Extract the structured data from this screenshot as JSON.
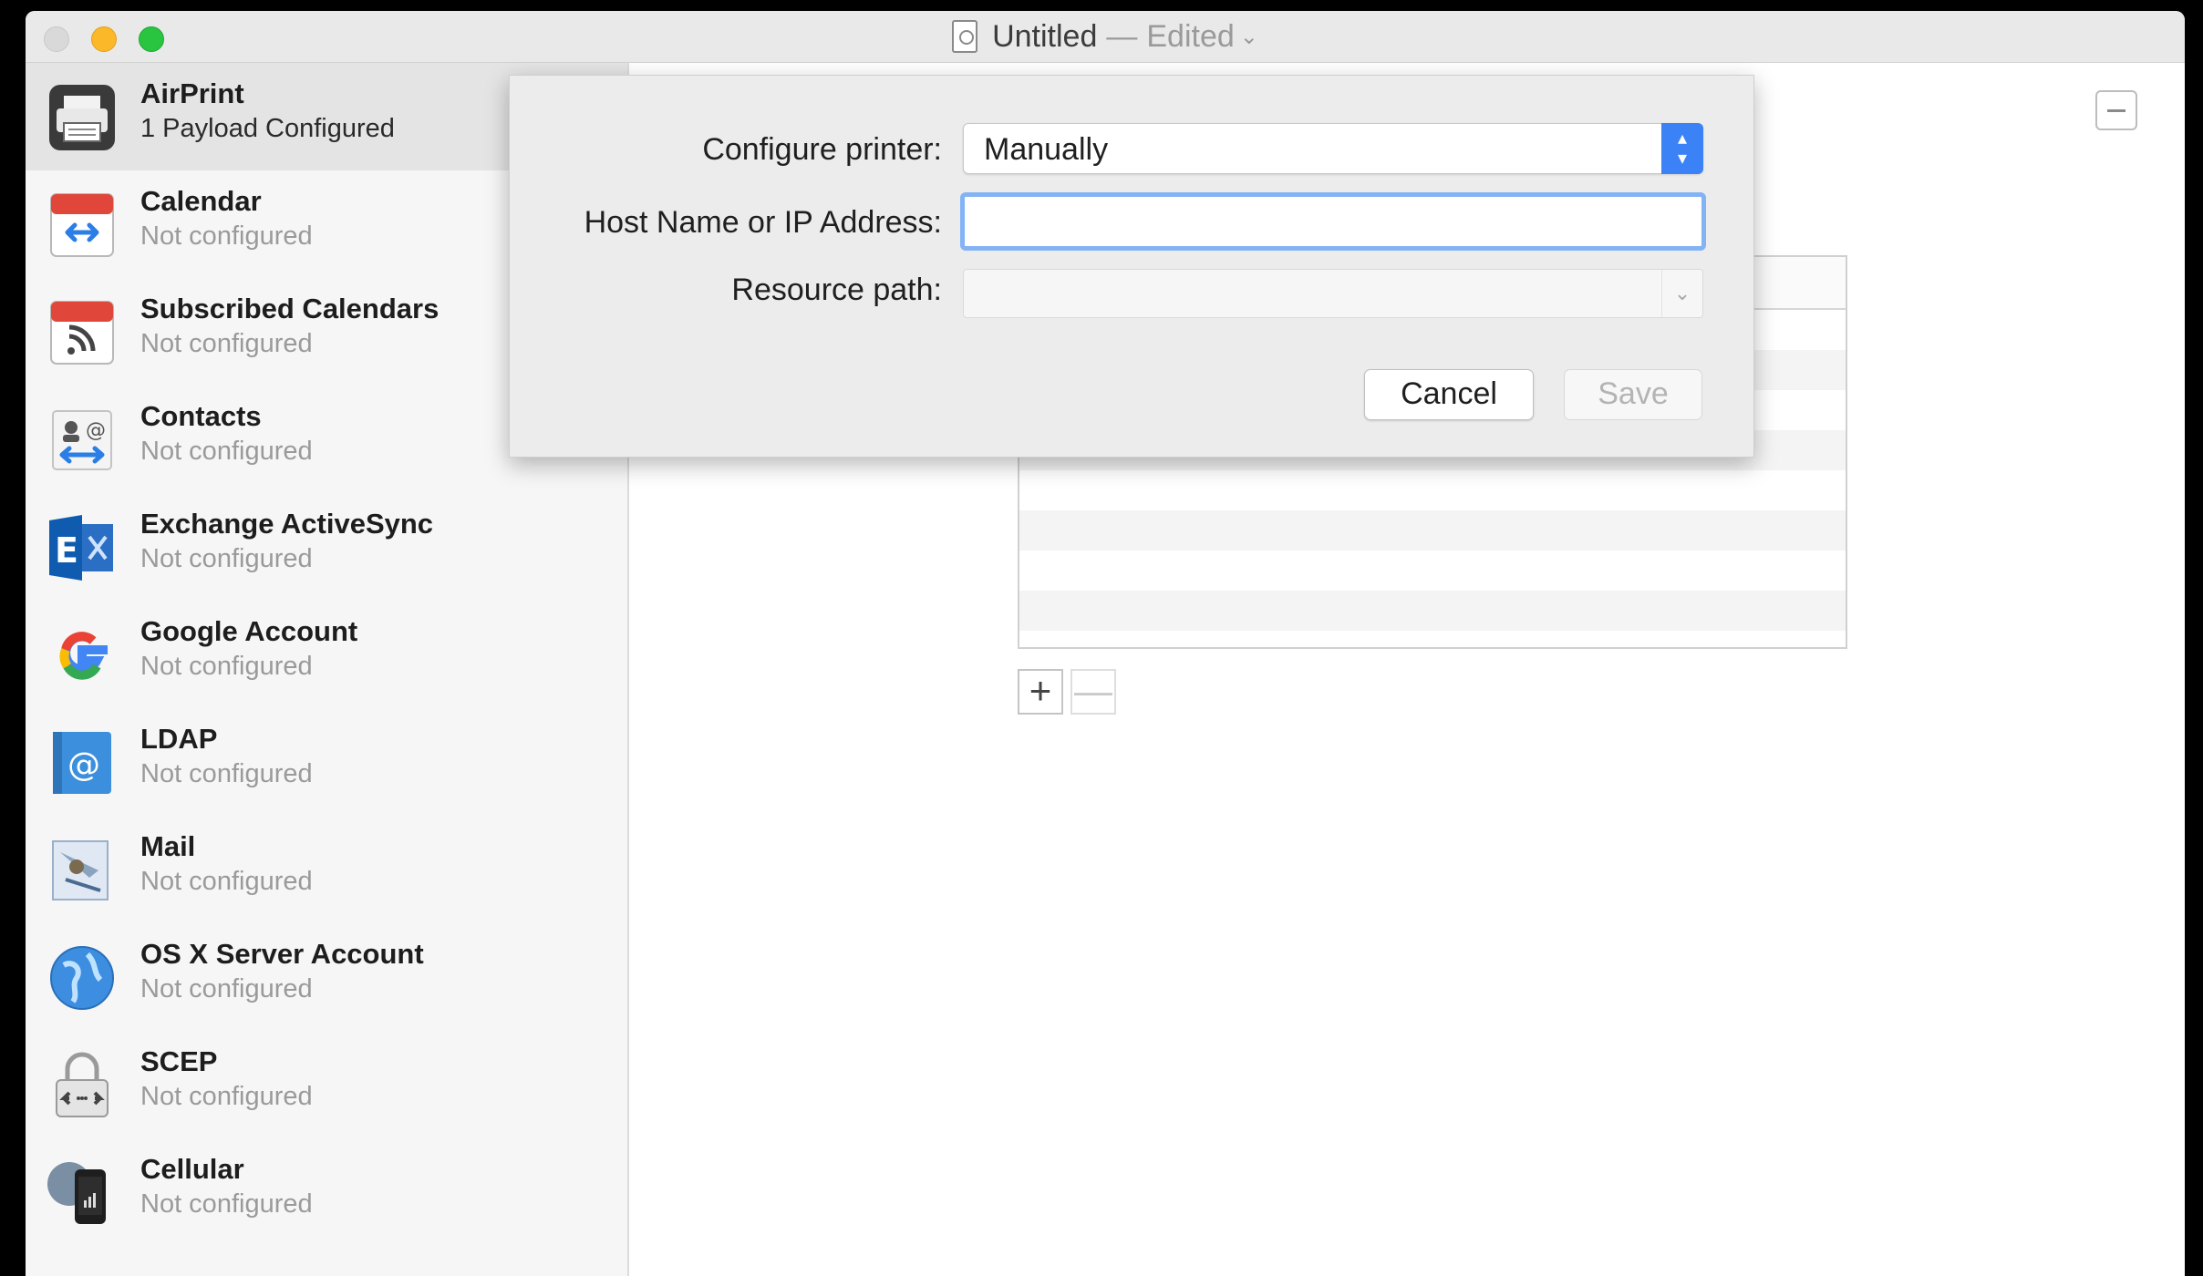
{
  "window": {
    "title": "Untitled",
    "separator": "—",
    "edited": "Edited",
    "chevron": "⌄"
  },
  "sidebar": {
    "items": [
      {
        "name": "AirPrint",
        "status": "1 Payload Configured",
        "icon": "printer-icon"
      },
      {
        "name": "Calendar",
        "status": "Not configured",
        "icon": "calendar-icon"
      },
      {
        "name": "Subscribed Calendars",
        "status": "Not configured",
        "icon": "subscribed-calendar-icon"
      },
      {
        "name": "Contacts",
        "status": "Not configured",
        "icon": "contacts-icon"
      },
      {
        "name": "Exchange ActiveSync",
        "status": "Not configured",
        "icon": "exchange-icon"
      },
      {
        "name": "Google Account",
        "status": "Not configured",
        "icon": "google-icon"
      },
      {
        "name": "LDAP",
        "status": "Not configured",
        "icon": "ldap-icon"
      },
      {
        "name": "Mail",
        "status": "Not configured",
        "icon": "mail-icon"
      },
      {
        "name": "OS X Server Account",
        "status": "Not configured",
        "icon": "globe-icon"
      },
      {
        "name": "SCEP",
        "status": "Not configured",
        "icon": "lock-icon"
      },
      {
        "name": "Cellular",
        "status": "Not configured",
        "icon": "cellular-icon"
      }
    ]
  },
  "sheet": {
    "configure_label": "Configure printer:",
    "configure_value": "Manually",
    "host_label": "Host Name or IP Address:",
    "host_value": "",
    "resource_label": "Resource path:",
    "resource_value": "",
    "cancel_label": "Cancel",
    "save_label": "Save"
  },
  "list_controls": {
    "add": "+",
    "remove": "—"
  },
  "colors": {
    "accent": "#3a82f6",
    "focus_ring": "#83b3f5",
    "sidebar_bg": "#f6f6f6",
    "selected_bg": "#e4e4e4"
  }
}
